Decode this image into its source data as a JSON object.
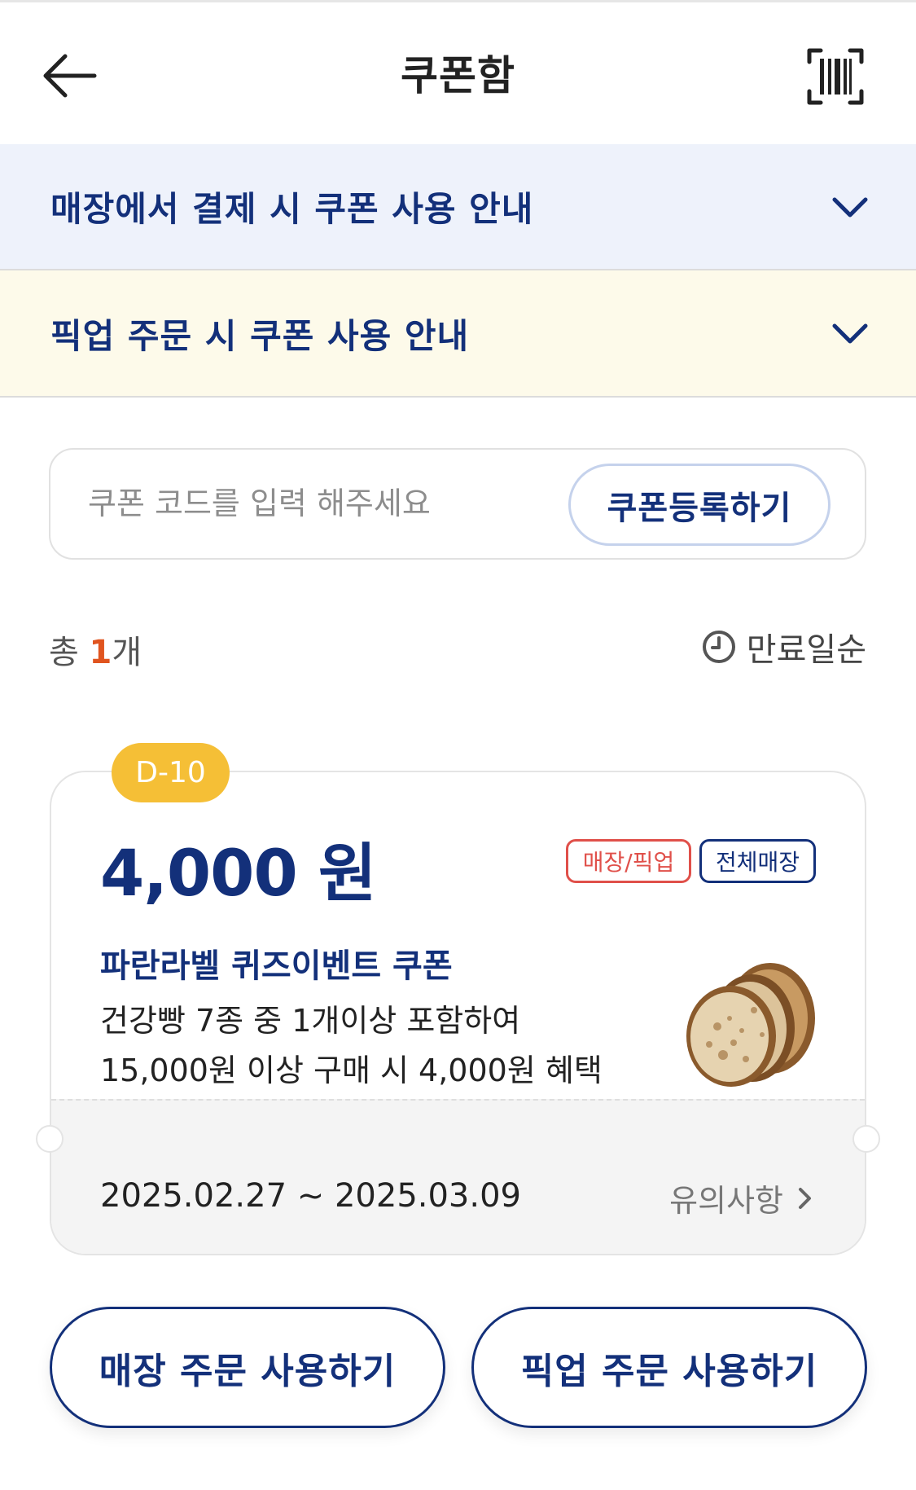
{
  "header": {
    "title": "쿠폰함",
    "back_icon": "arrow-left-icon",
    "barcode_icon": "barcode-scan-icon"
  },
  "accordions": {
    "store_payment_guide": "매장에서 결제 시 쿠폰 사용 안내",
    "pickup_order_guide": "픽업 주문 시 쿠폰 사용 안내"
  },
  "register": {
    "placeholder": "쿠폰 코드를 입력 해주세요",
    "value": "",
    "button_label": "쿠폰등록하기"
  },
  "summary": {
    "total_prefix": "총 ",
    "total_count": "1",
    "total_suffix": "개",
    "sort_label": "만료일순"
  },
  "coupon": {
    "dday": "D-10",
    "amount": "4,000 원",
    "tags": [
      "매장/픽업",
      "전체매장"
    ],
    "name": "파란라벨 퀴즈이벤트 쿠폰",
    "desc_line1": "건강빵 7종 중 1개이상 포함하여",
    "desc_line2": "15,000원 이상 구매 시 4,000원 혜택",
    "period": "2025.02.27 ~ 2025.03.09",
    "notice_label": "유의사항"
  },
  "actions": {
    "use_in_store": "매장 주문 사용하기",
    "use_pickup": "픽업 주문 사용하기"
  },
  "colors": {
    "brand_navy": "#13307a",
    "accent_orange": "#e0541f",
    "dday_yellow": "#f5bf36",
    "tag_red": "#e0504a",
    "store_bg": "#eef2fb",
    "pickup_bg": "#fdfaea"
  }
}
